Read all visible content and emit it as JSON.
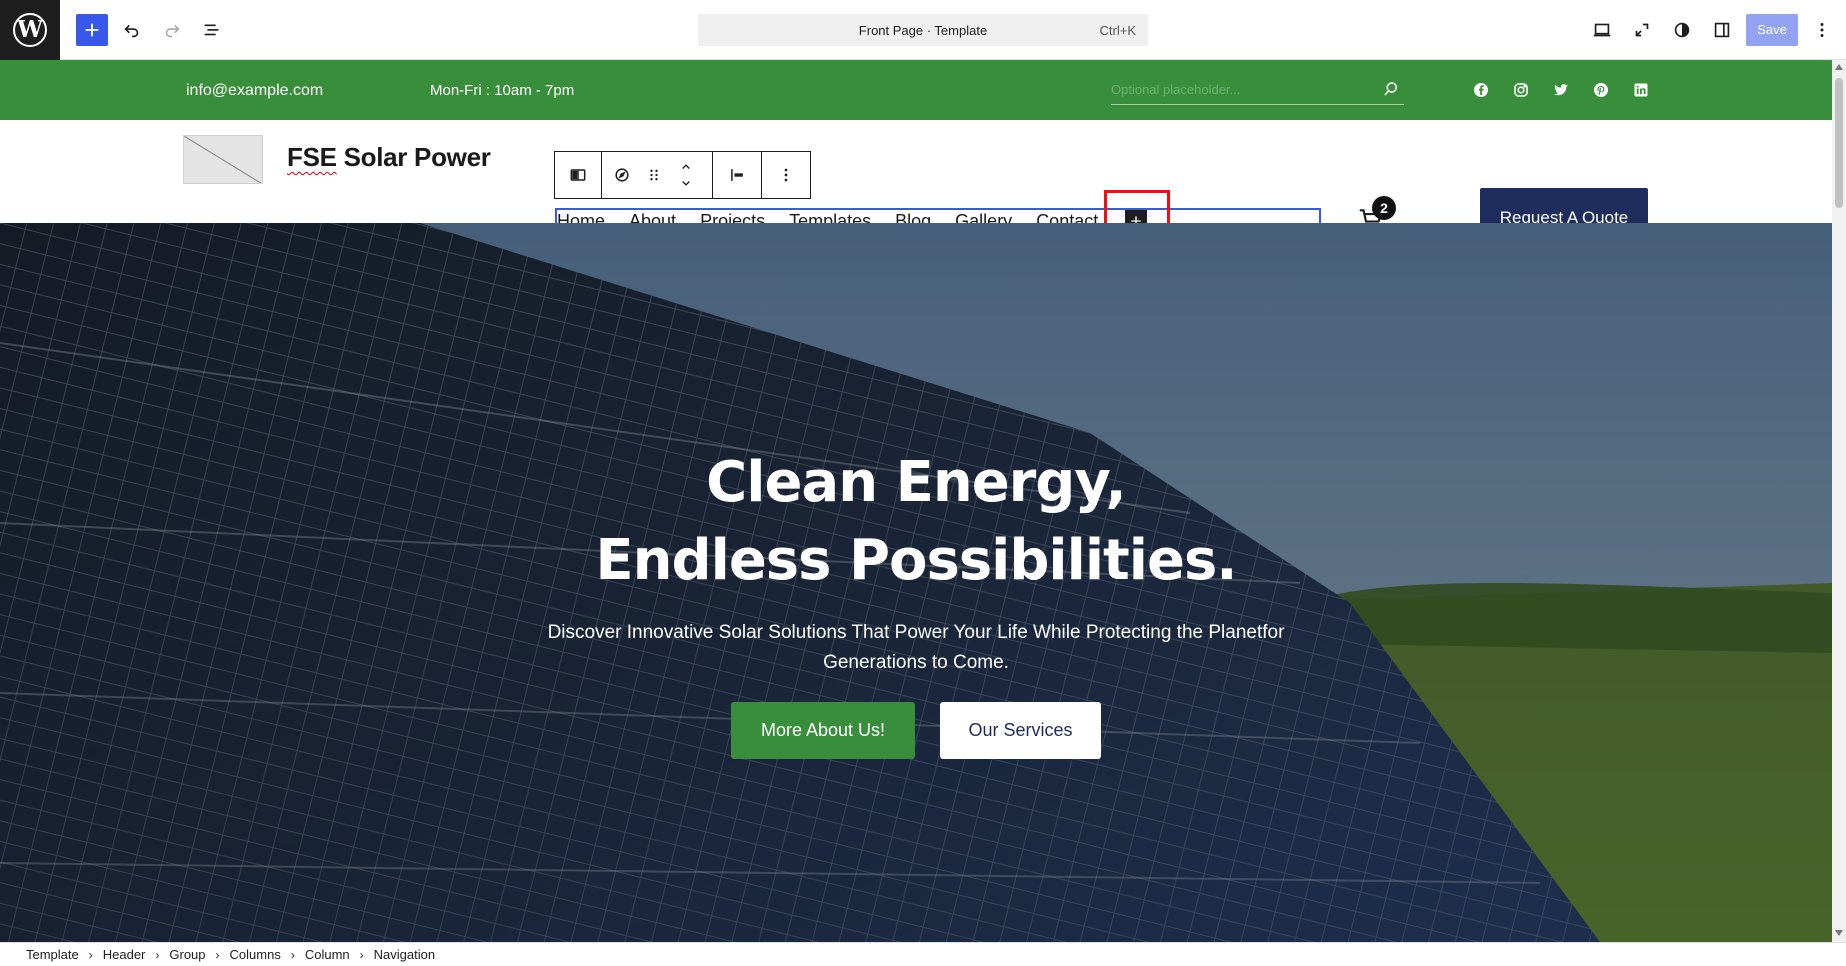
{
  "editor": {
    "command_bar": {
      "title": "Front Page · Template",
      "shortcut": "Ctrl+K"
    },
    "save_label": "Save",
    "icons": [
      "wordpress-logo",
      "plus-icon",
      "undo-icon",
      "redo-icon",
      "list-view-icon",
      "desktop-view-icon",
      "fullscreen-icon",
      "half-circle-styles-icon",
      "sidebar-settings-icon",
      "vertical-dots-icon"
    ]
  },
  "topstrip": {
    "email": "info@example.com",
    "hours": "Mon-Fri : 10am - 7pm",
    "search_placeholder": "Optional placeholder...",
    "social_icons": [
      "facebook-icon",
      "instagram-icon",
      "twitter-icon",
      "pinterest-icon",
      "linkedin-icon"
    ],
    "background_color": "#398e3b"
  },
  "header": {
    "site_title_prefix": "FSE",
    "site_title_rest": " Solar Power",
    "nav_items": [
      "Home",
      "About",
      "Projects",
      "Templates",
      "Blog",
      "Gallery",
      "Contact"
    ],
    "cart_count": "2",
    "quote_button": "Request A Quote",
    "quote_button_color": "#1f2d5e"
  },
  "hero": {
    "title_line1": "Clean Energy,",
    "title_line2": "Endless Possibilities.",
    "subtitle": "Discover Innovative Solar Solutions That Power Your Life While Protecting the Planetfor Generations to Come.",
    "primary_button": "More About Us!",
    "secondary_button": "Our Services"
  },
  "breadcrumb": [
    "Template",
    "Header",
    "Group",
    "Columns",
    "Column",
    "Navigation"
  ]
}
